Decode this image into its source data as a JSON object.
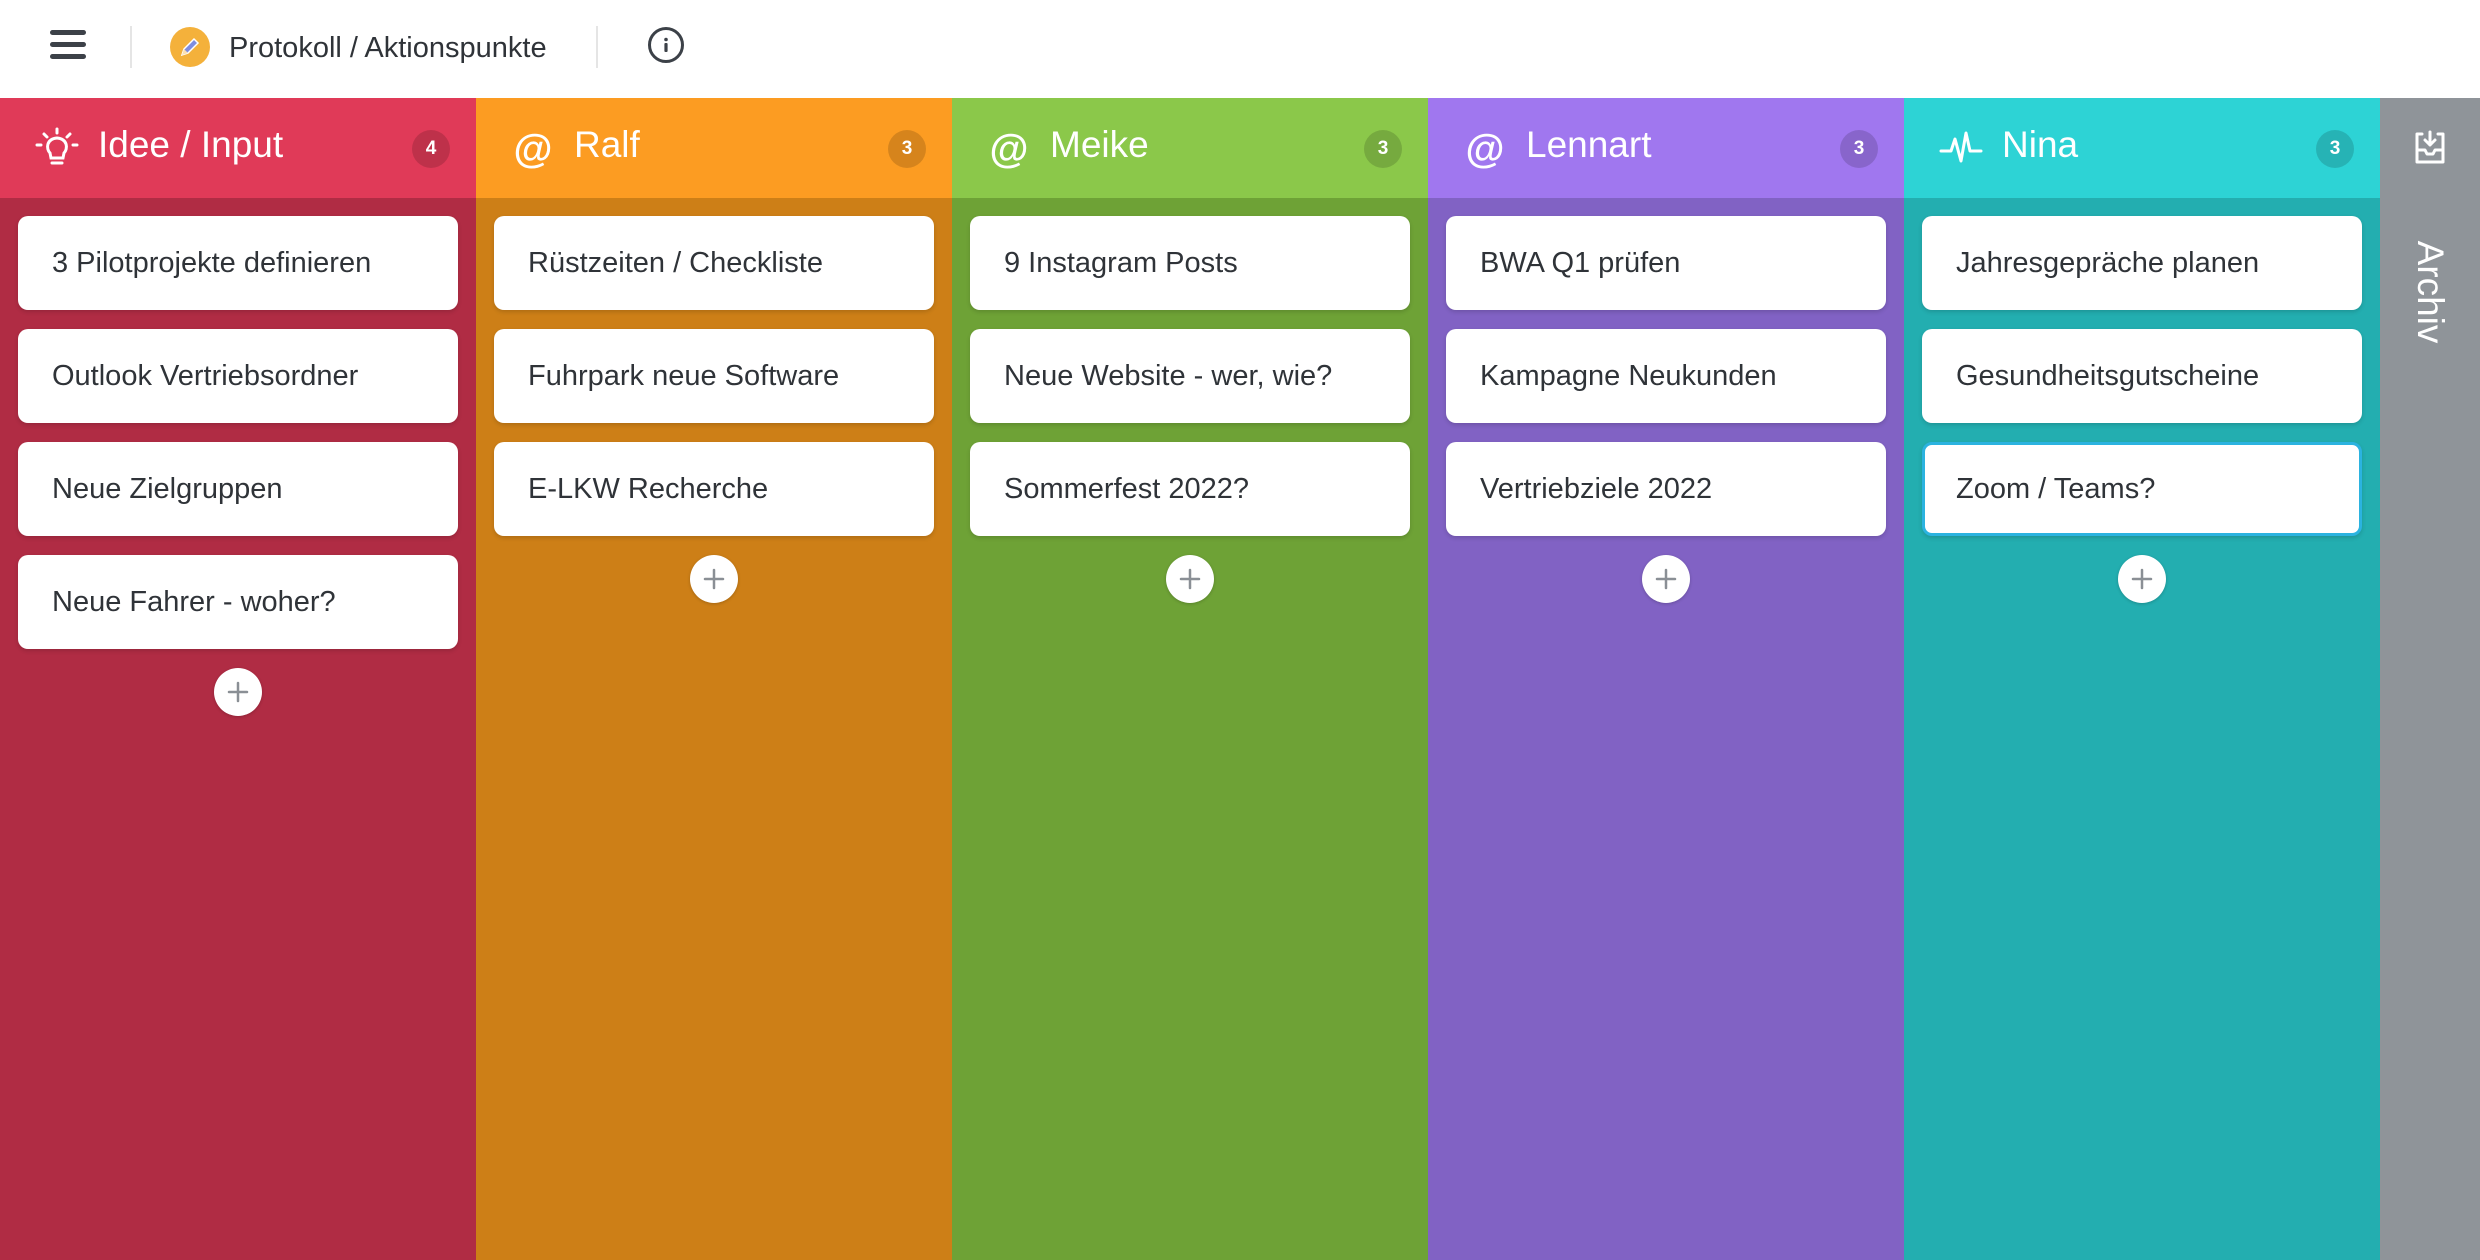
{
  "topbar": {
    "menu_icon": "hamburger-menu-icon",
    "board_icon": "pencil-emoji-icon",
    "board_title": "Protokoll / Aktionspunkte",
    "info_icon": "info-icon"
  },
  "columns": [
    {
      "title": "Idee / Input",
      "count": "4",
      "icon": "lightbulb-icon",
      "head_color": "#e03a58",
      "body_color": "#b02c44",
      "cards": [
        "3 Pilotprojekte definieren",
        "Outlook Vertriebsordner",
        "Neue Zielgruppen",
        "Neue Fahrer - woher?"
      ]
    },
    {
      "title": "Ralf",
      "count": "3",
      "icon": "at-icon",
      "head_color": "#fc9c22",
      "body_color": "#cd7f17",
      "cards": [
        "Rüstzeiten / Checkliste",
        "Fuhrpark neue Software",
        "E-LKW Recherche"
      ]
    },
    {
      "title": "Meike",
      "count": "3",
      "icon": "at-icon",
      "head_color": "#8bc84a",
      "body_color": "#6ea236",
      "cards": [
        "9 Instagram Posts",
        "Neue Website - wer, wie?",
        "Sommerfest 2022?"
      ]
    },
    {
      "title": "Lennart",
      "count": "3",
      "icon": "at-icon",
      "head_color": "#a077ef",
      "body_color": "#8162c4",
      "cards": [
        "BWA Q1 prüfen",
        "Kampagne Neukunden",
        "Vertriebziele 2022"
      ]
    },
    {
      "title": "Nina",
      "count": "3",
      "icon": "pulse-icon",
      "head_color": "#2dd3d5",
      "body_color": "#23aeb0",
      "cards": [
        "Jahresgepräche planen",
        "Gesundheitsgutscheine",
        "Zoom / Teams?"
      ]
    }
  ],
  "archive": {
    "label": "Archiv",
    "icon": "archive-download-icon",
    "color": "#8f9499"
  },
  "focus_color": "#2bb3e0",
  "add_icon": "plus-icon"
}
